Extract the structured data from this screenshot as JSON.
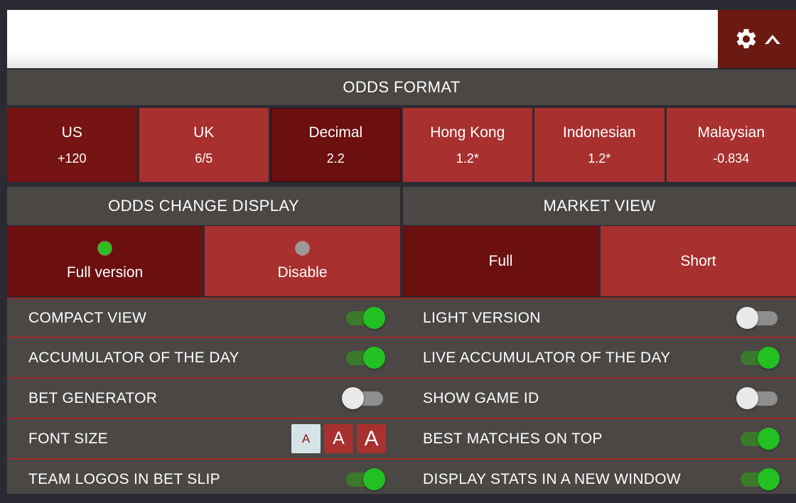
{
  "topbar": {
    "gear_icon": "gear-icon",
    "collapse_icon": "chevron-up-icon"
  },
  "odds_format": {
    "title": "ODDS FORMAT",
    "selected": "Decimal",
    "options": [
      {
        "name": "US",
        "value": "+120",
        "state": "alt"
      },
      {
        "name": "UK",
        "value": "6/5",
        "state": "normal"
      },
      {
        "name": "Decimal",
        "value": "2.2",
        "state": "selected"
      },
      {
        "name": "Hong Kong",
        "value": "1.2*",
        "state": "normal"
      },
      {
        "name": "Indonesian",
        "value": "1.2*",
        "state": "normal"
      },
      {
        "name": "Malaysian",
        "value": "-0.834",
        "state": "normal"
      }
    ]
  },
  "odds_change_display": {
    "title": "ODDS CHANGE DISPLAY",
    "selected": "Full version",
    "options": [
      {
        "label": "Full version",
        "state": "selected",
        "dot": "on"
      },
      {
        "label": "Disable",
        "state": "normal",
        "dot": "off"
      }
    ]
  },
  "market_view": {
    "title": "MARKET VIEW",
    "selected": "Full",
    "options": [
      {
        "label": "Full",
        "state": "selected"
      },
      {
        "label": "Short",
        "state": "normal"
      }
    ]
  },
  "settings_rows": [
    {
      "left": {
        "label": "COMPACT VIEW",
        "control": "toggle",
        "value": "on"
      },
      "right": {
        "label": "LIGHT VERSION",
        "control": "toggle",
        "value": "off"
      }
    },
    {
      "left": {
        "label": "ACCUMULATOR OF THE DAY",
        "control": "toggle",
        "value": "on"
      },
      "right": {
        "label": "LIVE ACCUMULATOR OF THE DAY",
        "control": "toggle",
        "value": "on"
      }
    },
    {
      "left": {
        "label": "BET GENERATOR",
        "control": "toggle",
        "value": "off"
      },
      "right": {
        "label": "SHOW GAME ID",
        "control": "toggle",
        "value": "off"
      }
    },
    {
      "left": {
        "label": "FONT SIZE",
        "control": "fontsize",
        "value": "small",
        "options": [
          {
            "glyph": "A",
            "size": "small",
            "state": "selected"
          },
          {
            "glyph": "A",
            "size": "medium",
            "state": "normal"
          },
          {
            "glyph": "A",
            "size": "large",
            "state": "normal"
          }
        ]
      },
      "right": {
        "label": "BEST MATCHES ON TOP",
        "control": "toggle",
        "value": "on"
      }
    },
    {
      "left": {
        "label": "TEAM LOGOS IN BET SLIP",
        "control": "toggle",
        "value": "on"
      },
      "right": {
        "label": "DISPLAY STATS IN A NEW WINDOW",
        "control": "toggle",
        "value": "on"
      }
    }
  ],
  "colors": {
    "brand_dark_red": "#6b0f0f",
    "brand_red": "#a8302f",
    "gear_bg": "#6b1a12",
    "band_gray": "#4a4745",
    "separator_red": "#a02a28",
    "toggle_on": "#22c022",
    "toggle_off": "#e9e9e9",
    "page_bg": "#2b2b33"
  }
}
